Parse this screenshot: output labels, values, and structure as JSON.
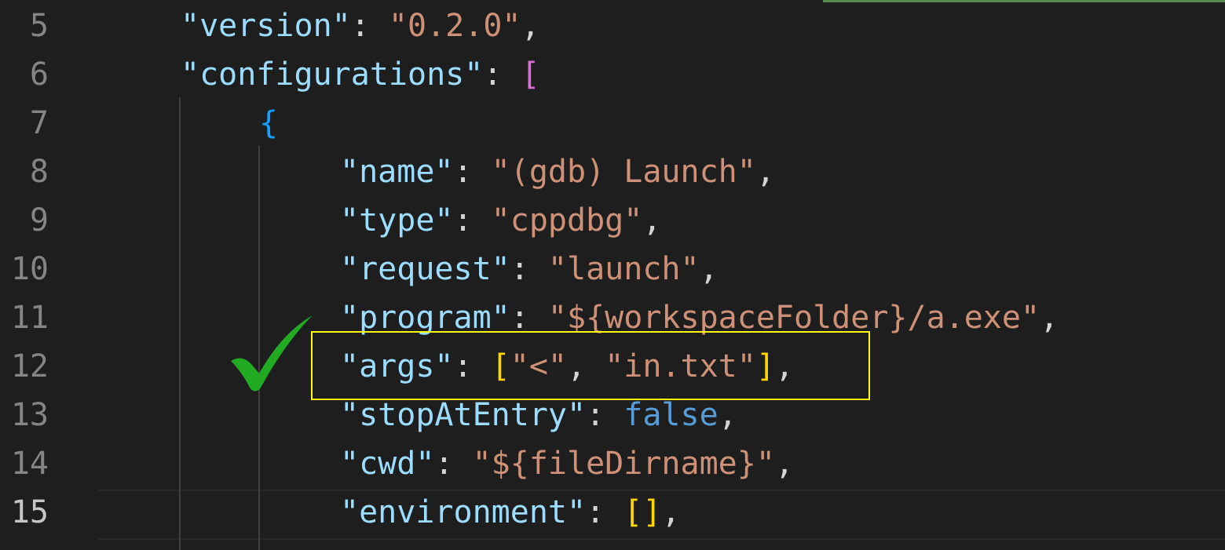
{
  "editor": {
    "lines": [
      {
        "num": "5",
        "tokens": [
          [
            "key",
            "\"version\""
          ],
          [
            "punc",
            ": "
          ],
          [
            "str",
            "\"0.2.0\""
          ],
          [
            "punc",
            ","
          ]
        ]
      },
      {
        "num": "6",
        "tokens": [
          [
            "key",
            "\"configurations\""
          ],
          [
            "punc",
            ": "
          ],
          [
            "br2",
            "["
          ]
        ]
      },
      {
        "num": "7",
        "tokens": [
          [
            "br3",
            "{"
          ]
        ]
      },
      {
        "num": "8",
        "tokens": [
          [
            "key",
            "\"name\""
          ],
          [
            "punc",
            ": "
          ],
          [
            "str",
            "\"(gdb) Launch\""
          ],
          [
            "punc",
            ","
          ]
        ]
      },
      {
        "num": "9",
        "tokens": [
          [
            "key",
            "\"type\""
          ],
          [
            "punc",
            ": "
          ],
          [
            "str",
            "\"cppdbg\""
          ],
          [
            "punc",
            ","
          ]
        ]
      },
      {
        "num": "10",
        "tokens": [
          [
            "key",
            "\"request\""
          ],
          [
            "punc",
            ": "
          ],
          [
            "str",
            "\"launch\""
          ],
          [
            "punc",
            ","
          ]
        ]
      },
      {
        "num": "11",
        "tokens": [
          [
            "key",
            "\"program\""
          ],
          [
            "punc",
            ": "
          ],
          [
            "str",
            "\"${workspaceFolder}/a.exe\""
          ],
          [
            "punc",
            ","
          ]
        ]
      },
      {
        "num": "12",
        "tokens": [
          [
            "key",
            "\"args\""
          ],
          [
            "punc",
            ": "
          ],
          [
            "br1",
            "["
          ],
          [
            "str",
            "\"<\""
          ],
          [
            "punc",
            ", "
          ],
          [
            "str",
            "\"in.txt\""
          ],
          [
            "br1",
            "]"
          ],
          [
            "punc",
            ","
          ]
        ]
      },
      {
        "num": "13",
        "tokens": [
          [
            "key",
            "\"stopAtEntry\""
          ],
          [
            "punc",
            ": "
          ],
          [
            "kw",
            "false"
          ],
          [
            "punc",
            ","
          ]
        ]
      },
      {
        "num": "14",
        "tokens": [
          [
            "key",
            "\"cwd\""
          ],
          [
            "punc",
            ": "
          ],
          [
            "str",
            "\"${fileDirname}\""
          ],
          [
            "punc",
            ","
          ]
        ]
      },
      {
        "num": "15",
        "tokens": [
          [
            "key",
            "\"environment\""
          ],
          [
            "punc",
            ": "
          ],
          [
            "br1",
            "[]"
          ],
          [
            "punc",
            ","
          ]
        ]
      }
    ],
    "active_line": "15"
  },
  "annotations": {
    "checkmark_color": "#22aa22",
    "highlight_color": "#ffff00",
    "highlighted_line": "12"
  },
  "colors": {
    "background": "#1e1e1e",
    "key": "#9cdcfe",
    "string": "#ce9178",
    "keyword": "#569cd6"
  }
}
